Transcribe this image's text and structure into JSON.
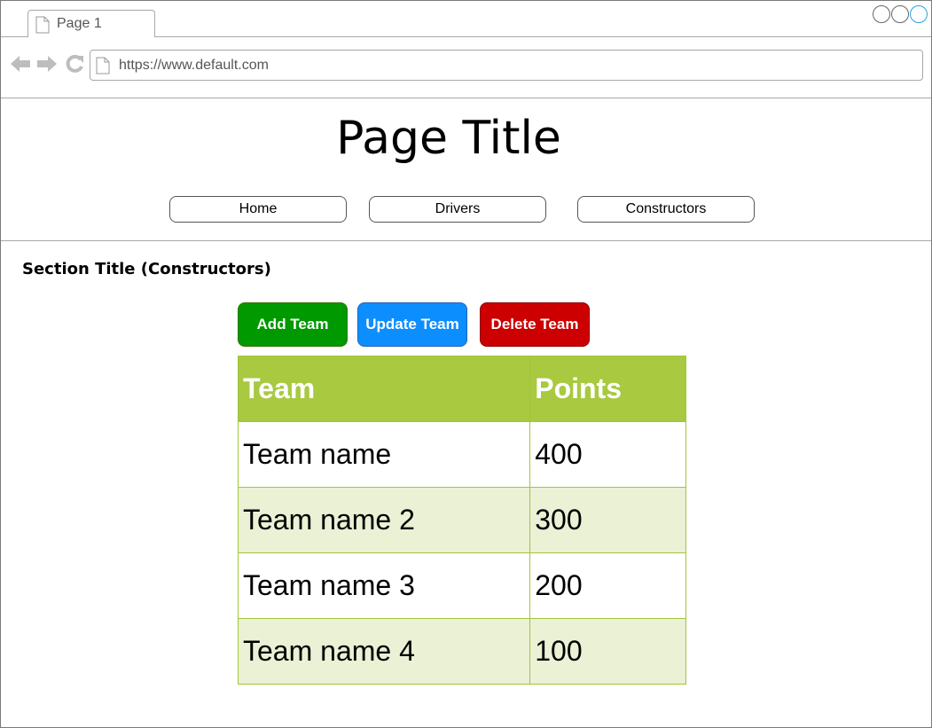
{
  "browser": {
    "tab_title": "Page 1",
    "url": "https://www.default.com"
  },
  "page": {
    "title": "Page Title",
    "nav": [
      {
        "label": "Home"
      },
      {
        "label": "Drivers"
      },
      {
        "label": "Constructors"
      }
    ],
    "section_title": "Section Title (Constructors)"
  },
  "actions": {
    "add_label": "Add Team",
    "update_label": "Update Team",
    "delete_label": "Delete Team"
  },
  "table": {
    "headers": [
      "Team",
      "Points"
    ],
    "rows": [
      [
        "Team name",
        "400"
      ],
      [
        "Team name 2",
        "300"
      ],
      [
        "Team name 3",
        "200"
      ],
      [
        "Team name 4",
        "100"
      ]
    ]
  },
  "colors": {
    "add": "#009900",
    "update": "#0d8eff",
    "delete": "#cc0000",
    "table_header": "#a8c940",
    "table_alt_row": "#eaf1d5"
  },
  "icons": [
    "page-icon",
    "back-arrow-icon",
    "forward-arrow-icon",
    "reload-icon"
  ]
}
